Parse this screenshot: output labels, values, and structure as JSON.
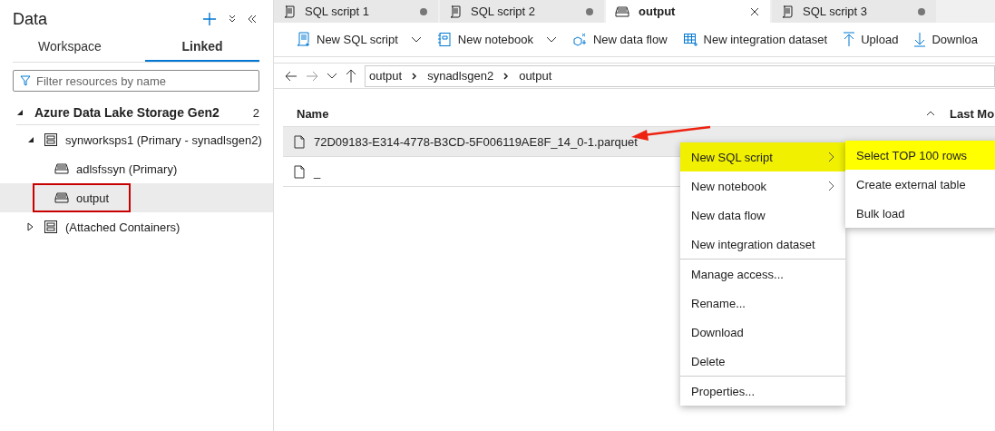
{
  "sidebar": {
    "title": "Data",
    "tabs": [
      {
        "label": "Workspace",
        "selected": false
      },
      {
        "label": "Linked",
        "selected": true
      }
    ],
    "filter": {
      "placeholder": "Filter resources by name"
    },
    "section": {
      "title": "Azure Data Lake Storage Gen2",
      "count": "2",
      "expanded": true,
      "children": [
        {
          "label": "synworksps1 (Primary - synadlsgen2)",
          "expanded": true,
          "children": [
            {
              "label": "adlsfssyn (Primary)",
              "selected": false,
              "outlined": false
            },
            {
              "label": "output",
              "selected": true,
              "outlined": true
            }
          ]
        },
        {
          "label": "(Attached Containers)",
          "expanded": false
        }
      ]
    }
  },
  "tabs": [
    {
      "label": "SQL script 1",
      "kind": "script",
      "selected": false,
      "unsaved": true
    },
    {
      "label": "SQL script 2",
      "kind": "script",
      "selected": false,
      "unsaved": true
    },
    {
      "label": "output",
      "kind": "container",
      "selected": true,
      "unsaved": false
    },
    {
      "label": "SQL script 3",
      "kind": "script",
      "selected": false,
      "unsaved": true
    }
  ],
  "toolbar": [
    {
      "label": "New SQL script",
      "kind": "script",
      "dropdown": true
    },
    {
      "label": "New notebook",
      "kind": "notebook",
      "dropdown": true
    },
    {
      "label": "New data flow",
      "kind": "dataflow",
      "dropdown": false
    },
    {
      "label": "New integration dataset",
      "kind": "dataset",
      "dropdown": false
    },
    {
      "label": "Upload",
      "kind": "upload",
      "dropdown": false
    },
    {
      "label": "Downloa",
      "kind": "download",
      "dropdown": false
    }
  ],
  "breadcrumb": [
    "output",
    "synadlsgen2",
    "output"
  ],
  "table": {
    "columns": [
      {
        "label": "Name",
        "sort_ascending": true
      },
      {
        "label": "Last Mo"
      }
    ],
    "rows": [
      {
        "name": "72D09183-E314-4778-B3CD-5F006119AE8F_14_0-1.parquet",
        "selected": true
      },
      {
        "name": "_",
        "selected": false
      }
    ]
  },
  "context_menu": [
    {
      "label": "New SQL script",
      "submenu": true,
      "highlighted": true,
      "divider_before": false
    },
    {
      "label": "New notebook",
      "submenu": true,
      "highlighted": false,
      "divider_before": false
    },
    {
      "label": "New data flow",
      "submenu": false,
      "highlighted": false,
      "divider_before": false
    },
    {
      "label": "New integration dataset",
      "submenu": false,
      "highlighted": false,
      "divider_before": false
    },
    {
      "label": "Manage access...",
      "submenu": false,
      "highlighted": false,
      "divider_before": true
    },
    {
      "label": "Rename...",
      "submenu": false,
      "highlighted": false,
      "divider_before": false
    },
    {
      "label": "Download",
      "submenu": false,
      "highlighted": false,
      "divider_before": false
    },
    {
      "label": "Delete",
      "submenu": false,
      "highlighted": false,
      "divider_before": false
    },
    {
      "label": "Properties...",
      "submenu": false,
      "highlighted": false,
      "divider_before": true
    }
  ],
  "submenu": [
    {
      "label": "Select TOP 100 rows",
      "highlighted": true
    },
    {
      "label": "Create external table",
      "highlighted": false
    },
    {
      "label": "Bulk load",
      "highlighted": false
    }
  ]
}
